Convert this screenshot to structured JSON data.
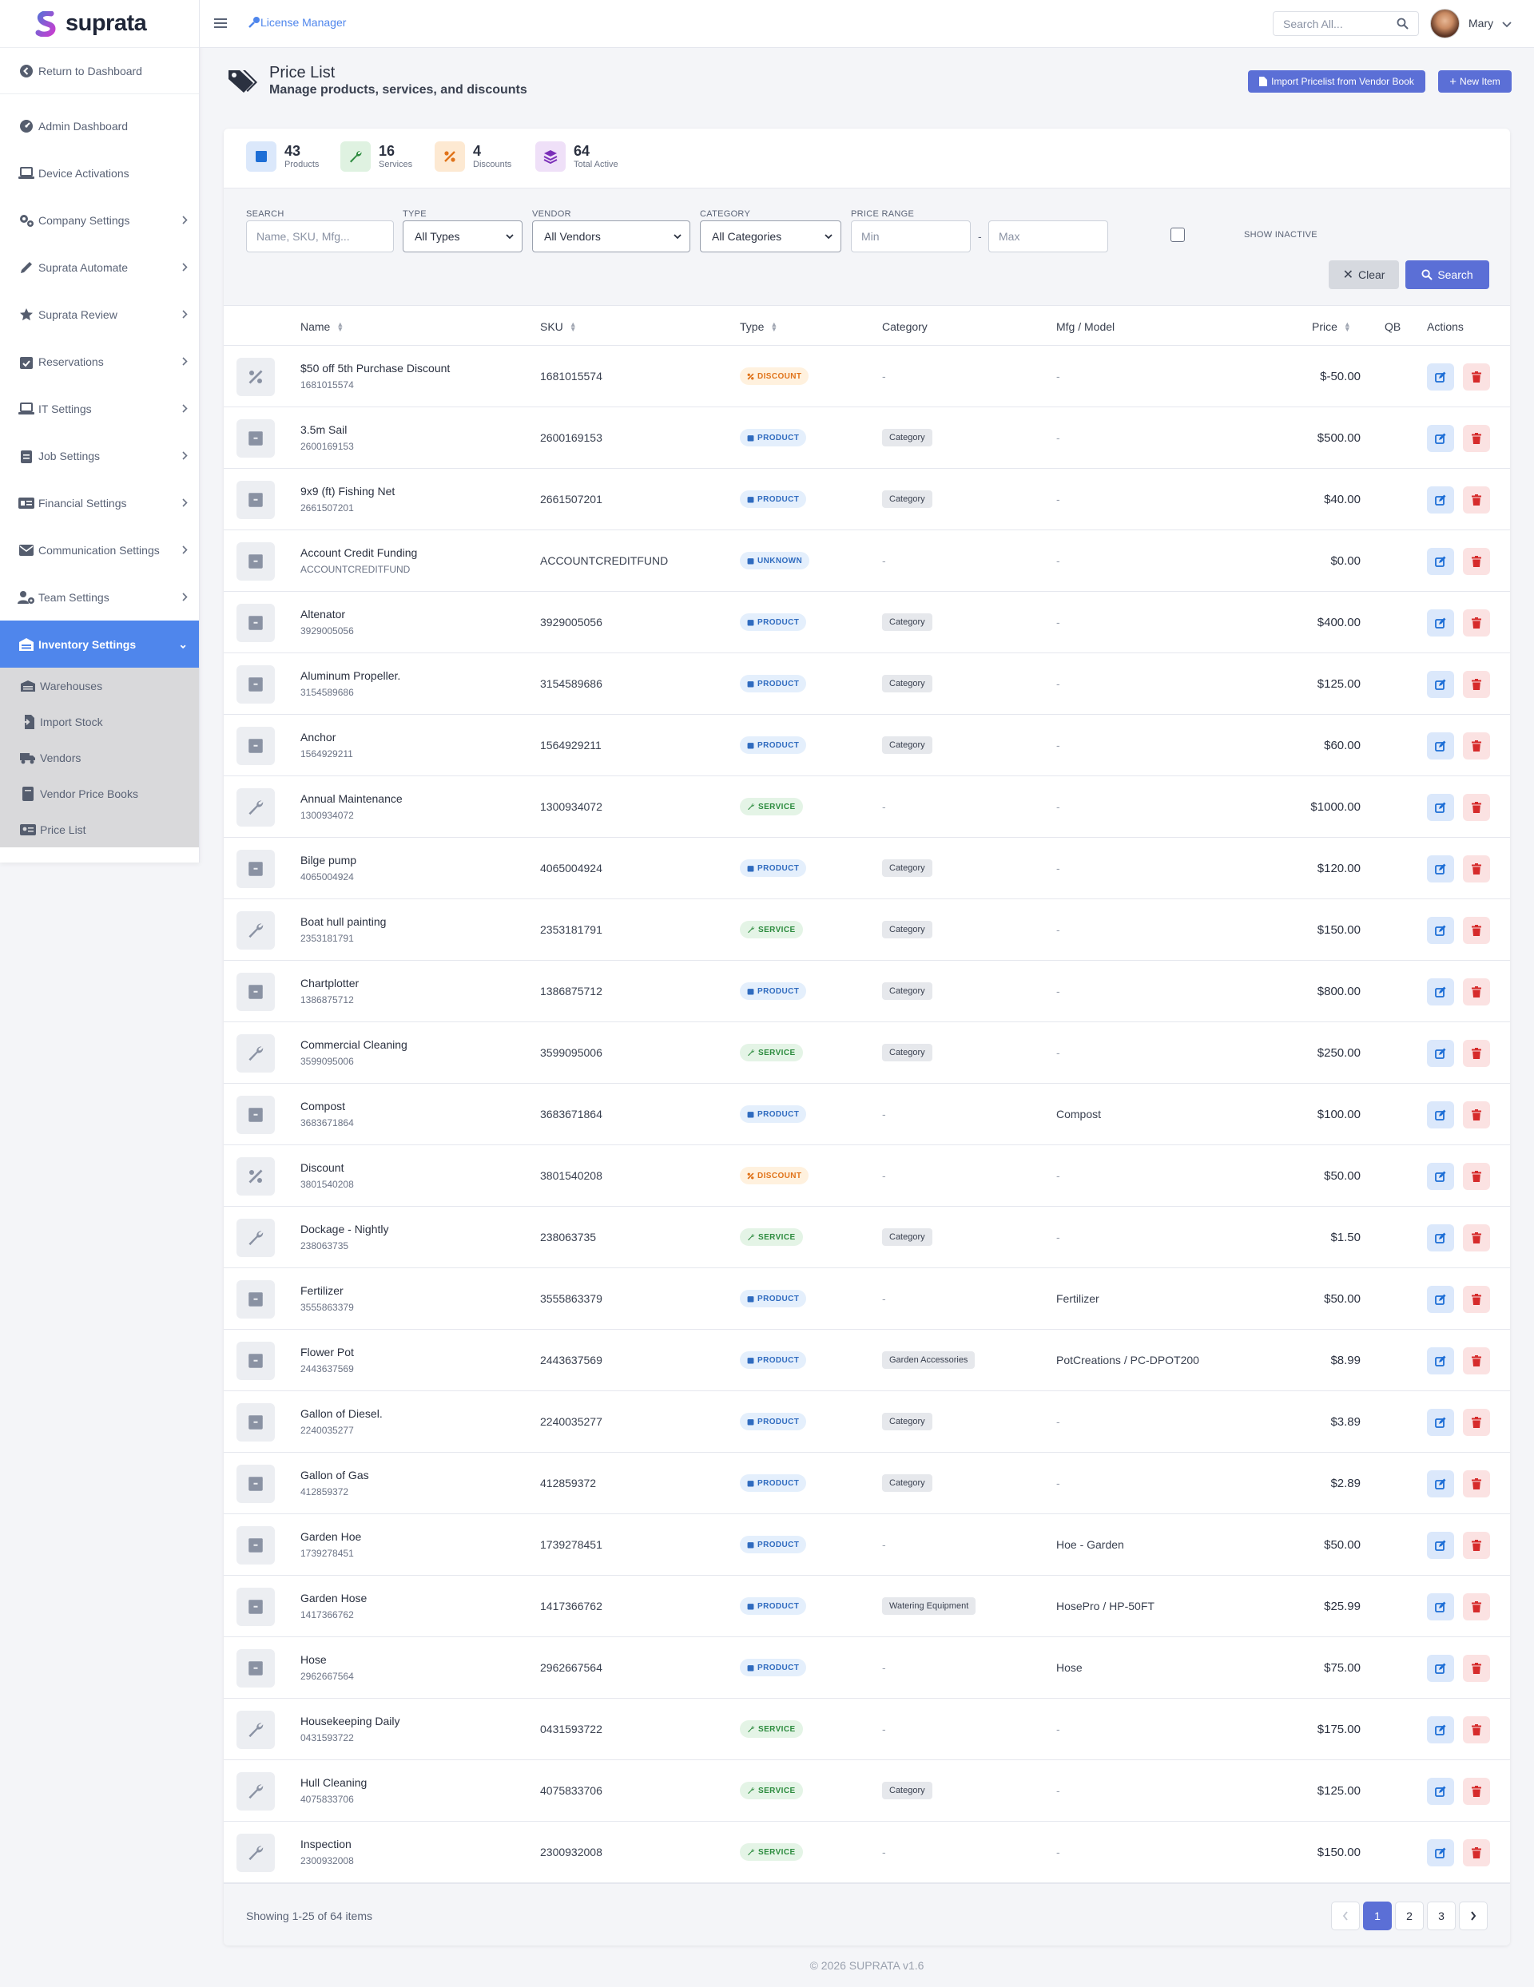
{
  "brand": {
    "name": "suprata"
  },
  "topbar": {
    "app_link": "License Manager",
    "search_placeholder": "Search All...",
    "user_name": "Mary"
  },
  "sidebar": {
    "return": "Return to Dashboard",
    "items": [
      {
        "label": "Admin Dashboard",
        "icon": "gauge-icon",
        "chevron": false
      },
      {
        "label": "Device Activations",
        "icon": "laptop-icon",
        "chevron": false
      },
      {
        "label": "Company Settings",
        "icon": "gears-icon",
        "chevron": true
      },
      {
        "label": "Suprata Automate",
        "icon": "pen-icon",
        "chevron": true
      },
      {
        "label": "Suprata Review",
        "icon": "star-icon",
        "chevron": true
      },
      {
        "label": "Reservations",
        "icon": "calendar-check-icon",
        "chevron": true
      },
      {
        "label": "IT Settings",
        "icon": "laptop-icon",
        "chevron": true
      },
      {
        "label": "Job Settings",
        "icon": "clipboard-icon",
        "chevron": true
      },
      {
        "label": "Financial Settings",
        "icon": "money-icon",
        "chevron": true
      },
      {
        "label": "Communication Settings",
        "icon": "envelope-icon",
        "chevron": true
      },
      {
        "label": "Team Settings",
        "icon": "users-gear-icon",
        "chevron": true
      }
    ],
    "active": "Inventory Settings",
    "sub_items": [
      {
        "label": "Warehouses",
        "icon": "warehouse-icon"
      },
      {
        "label": "Import Stock",
        "icon": "import-icon"
      },
      {
        "label": "Vendors",
        "icon": "truck-icon"
      },
      {
        "label": "Vendor Price Books",
        "icon": "book-icon"
      },
      {
        "label": "Price List",
        "icon": "id-card-icon"
      }
    ]
  },
  "header": {
    "title": "Price List",
    "subtitle": "Manage products, services, and discounts",
    "import_button": "Import Pricelist from Vendor Book",
    "new_button": "New Item"
  },
  "stats": [
    {
      "num": "43",
      "label": "Products",
      "color": "#1d6ed6",
      "bg": "#dbe8fb"
    },
    {
      "num": "16",
      "label": "Services",
      "color": "#2c8b3e",
      "bg": "#dff2e1"
    },
    {
      "num": "4",
      "label": "Discounts",
      "color": "#e0731a",
      "bg": "#fde9d2"
    },
    {
      "num": "64",
      "label": "Total Active",
      "color": "#7b2fb8",
      "bg": "#efe0f8"
    }
  ],
  "filters": {
    "search_label": "SEARCH",
    "search_placeholder": "Name, SKU, Mfg...",
    "type_label": "TYPE",
    "type_value": "All Types",
    "vendor_label": "VENDOR",
    "vendor_value": "All Vendors",
    "category_label": "CATEGORY",
    "category_value": "All Categories",
    "price_label": "PRICE RANGE",
    "min_placeholder": "Min",
    "max_placeholder": "Max",
    "dash": "-",
    "show_inactive": "SHOW INACTIVE",
    "clear": "Clear",
    "search": "Search"
  },
  "table": {
    "columns": {
      "name": "Name",
      "sku": "SKU",
      "type": "Type",
      "category": "Category",
      "mfg": "Mfg / Model",
      "price": "Price",
      "qb": "QB",
      "actions": "Actions"
    },
    "rows": [
      {
        "name": "$50 off 5th Purchase Discount",
        "sku": "1681015574",
        "type": "DISCOUNT",
        "category": "-",
        "mfg": "-",
        "price": "$-50.00"
      },
      {
        "name": "3.5m Sail",
        "sku": "2600169153",
        "type": "PRODUCT",
        "category": "Category",
        "mfg": "-",
        "price": "$500.00"
      },
      {
        "name": "9x9 (ft) Fishing Net",
        "sku": "2661507201",
        "type": "PRODUCT",
        "category": "Category",
        "mfg": "-",
        "price": "$40.00"
      },
      {
        "name": "Account Credit Funding",
        "sku": "ACCOUNTCREDITFUND",
        "type": "UNKNOWN",
        "category": "-",
        "mfg": "-",
        "price": "$0.00"
      },
      {
        "name": "Altenator",
        "sku": "3929005056",
        "type": "PRODUCT",
        "category": "Category",
        "mfg": "-",
        "price": "$400.00"
      },
      {
        "name": "Aluminum Propeller.",
        "sku": "3154589686",
        "type": "PRODUCT",
        "category": "Category",
        "mfg": "-",
        "price": "$125.00"
      },
      {
        "name": "Anchor",
        "sku": "1564929211",
        "type": "PRODUCT",
        "category": "Category",
        "mfg": "-",
        "price": "$60.00"
      },
      {
        "name": "Annual Maintenance",
        "sku": "1300934072",
        "type": "SERVICE",
        "category": "-",
        "mfg": "-",
        "price": "$1000.00"
      },
      {
        "name": "Bilge pump",
        "sku": "4065004924",
        "type": "PRODUCT",
        "category": "Category",
        "mfg": "-",
        "price": "$120.00"
      },
      {
        "name": "Boat hull painting",
        "sku": "2353181791",
        "type": "SERVICE",
        "category": "Category",
        "mfg": "-",
        "price": "$150.00"
      },
      {
        "name": "Chartplotter",
        "sku": "1386875712",
        "type": "PRODUCT",
        "category": "Category",
        "mfg": "-",
        "price": "$800.00"
      },
      {
        "name": "Commercial Cleaning",
        "sku": "3599095006",
        "type": "SERVICE",
        "category": "Category",
        "mfg": "-",
        "price": "$250.00"
      },
      {
        "name": "Compost",
        "sku": "3683671864",
        "type": "PRODUCT",
        "category": "-",
        "mfg": "Compost",
        "price": "$100.00"
      },
      {
        "name": "Discount",
        "sku": "3801540208",
        "type": "DISCOUNT",
        "category": "-",
        "mfg": "-",
        "price": "$50.00"
      },
      {
        "name": "Dockage - Nightly",
        "sku": "238063735",
        "type": "SERVICE",
        "category": "Category",
        "mfg": "-",
        "price": "$1.50"
      },
      {
        "name": "Fertilizer",
        "sku": "3555863379",
        "type": "PRODUCT",
        "category": "-",
        "mfg": "Fertilizer",
        "price": "$50.00"
      },
      {
        "name": "Flower Pot",
        "sku": "2443637569",
        "type": "PRODUCT",
        "category": "Garden Accessories",
        "mfg": "PotCreations / PC-DPOT200",
        "price": "$8.99"
      },
      {
        "name": "Gallon of Diesel.",
        "sku": "2240035277",
        "type": "PRODUCT",
        "category": "Category",
        "mfg": "-",
        "price": "$3.89"
      },
      {
        "name": "Gallon of Gas",
        "sku": "412859372",
        "type": "PRODUCT",
        "category": "Category",
        "mfg": "-",
        "price": "$2.89"
      },
      {
        "name": "Garden Hoe",
        "sku": "1739278451",
        "type": "PRODUCT",
        "category": "-",
        "mfg": "Hoe - Garden",
        "price": "$50.00"
      },
      {
        "name": "Garden Hose",
        "sku": "1417366762",
        "type": "PRODUCT",
        "category": "Watering Equipment",
        "mfg": "HosePro / HP-50FT",
        "price": "$25.99"
      },
      {
        "name": "Hose",
        "sku": "2962667564",
        "type": "PRODUCT",
        "category": "-",
        "mfg": "Hose",
        "price": "$75.00"
      },
      {
        "name": "Housekeeping Daily",
        "sku": "0431593722",
        "type": "SERVICE",
        "category": "-",
        "mfg": "-",
        "price": "$175.00"
      },
      {
        "name": "Hull Cleaning",
        "sku": "4075833706",
        "type": "SERVICE",
        "category": "Category",
        "mfg": "-",
        "price": "$125.00"
      },
      {
        "name": "Inspection",
        "sku": "2300932008",
        "type": "SERVICE",
        "category": "-",
        "mfg": "-",
        "price": "$150.00"
      }
    ]
  },
  "pagination": {
    "showing": "Showing 1-25 of 64 items",
    "pages": [
      "1",
      "2",
      "3"
    ],
    "current": "1"
  },
  "footer": {
    "copyright": "© 2026 SUPRATA v1.6"
  }
}
